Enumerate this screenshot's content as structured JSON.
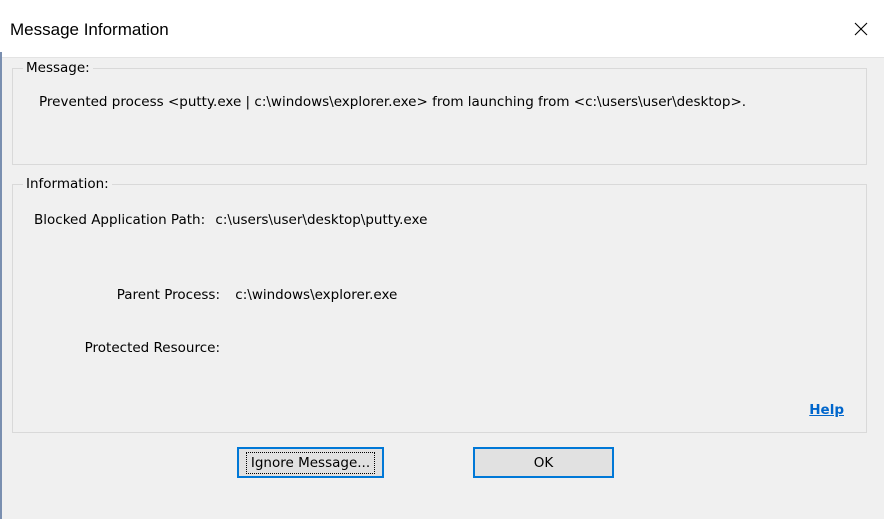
{
  "window": {
    "title": "Message Information"
  },
  "message_group": {
    "label": "Message:",
    "text": "Prevented process <putty.exe | c:\\windows\\explorer.exe> from launching from <c:\\users\\user\\desktop>."
  },
  "information_group": {
    "label": "Information:",
    "blocked_path_label": "Blocked Application Path:",
    "blocked_path_value": "c:\\users\\user\\desktop\\putty.exe",
    "parent_process_label": "Parent Process:",
    "parent_process_value": "c:\\windows\\explorer.exe",
    "protected_resource_label": "Protected Resource:",
    "protected_resource_value": "",
    "help_link": "Help"
  },
  "buttons": {
    "ignore_label": "Ignore Message...",
    "ok_label": "OK"
  },
  "colors": {
    "link": "#0066cc",
    "button_focus_border": "#0078d7",
    "background": "#f0f0f0"
  },
  "icons": {
    "close": "close-icon"
  }
}
